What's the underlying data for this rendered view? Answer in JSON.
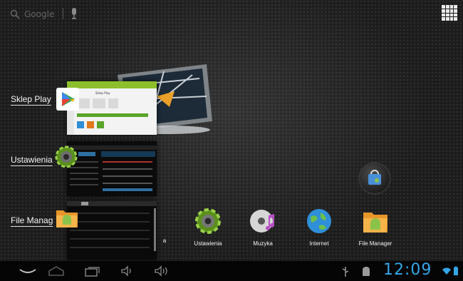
{
  "search": {
    "label": "Google"
  },
  "recent_apps": [
    {
      "label": "Sklep Play"
    },
    {
      "label": "Ustawienia"
    },
    {
      "label": "File Manag"
    }
  ],
  "thumbnails": {
    "play_store_title": "Sklep Play"
  },
  "dock": [
    {
      "label": "a"
    },
    {
      "label": "Ustawienia"
    },
    {
      "label": "Muzyka"
    },
    {
      "label": "Internet"
    },
    {
      "label": "File Manager"
    }
  ],
  "status": {
    "time": "12:09"
  },
  "colors": {
    "accent": "#35a6e6",
    "green": "#8dbf2c"
  },
  "icons": [
    "search-icon",
    "mic-icon",
    "all-apps-icon",
    "back-icon",
    "home-icon",
    "recent-apps-icon",
    "volume-down-icon",
    "volume-up-icon",
    "usb-icon",
    "android-debug-icon",
    "wifi-icon",
    "battery-icon"
  ]
}
